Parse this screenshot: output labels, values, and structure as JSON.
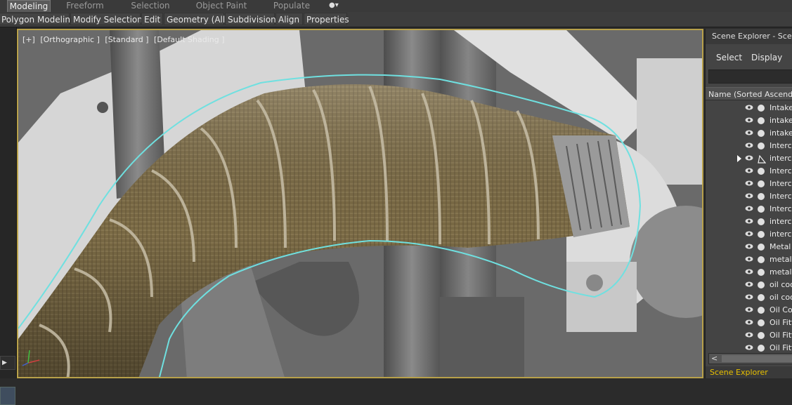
{
  "tabs": [
    {
      "label": "Modeling",
      "active": true
    },
    {
      "label": "Freeform",
      "active": false
    },
    {
      "label": "Selection",
      "active": false
    },
    {
      "label": "Object Paint",
      "active": false
    },
    {
      "label": "Populate",
      "active": false
    }
  ],
  "ribbon": {
    "buttons": [
      "Polygon Modeling",
      "Modify Selection",
      "Edit",
      "Geometry (All)",
      "Subdivision",
      "Align",
      "Properties"
    ]
  },
  "viewport": {
    "label_plus": "[+]",
    "label_view": "[Orthographic ]",
    "label_style": "[Standard ]",
    "label_shading": "[Default Shading ]"
  },
  "scene_explorer": {
    "title": "Scene Explorer - Scene",
    "menu": [
      "Select",
      "Display"
    ],
    "column_header": "Name (Sorted Ascending)",
    "rows": [
      {
        "label": "Intake",
        "selected": false
      },
      {
        "label": "intake",
        "selected": false
      },
      {
        "label": "intake",
        "selected": false
      },
      {
        "label": "Interco",
        "selected": false
      },
      {
        "label": "interco",
        "selected": true
      },
      {
        "label": "Interco",
        "selected": false
      },
      {
        "label": "Interco",
        "selected": false
      },
      {
        "label": "Interco",
        "selected": false
      },
      {
        "label": "Interco",
        "selected": false
      },
      {
        "label": "interco",
        "selected": false
      },
      {
        "label": "interco",
        "selected": false
      },
      {
        "label": "Metal C",
        "selected": false
      },
      {
        "label": "metal c",
        "selected": false
      },
      {
        "label": "metal c",
        "selected": false
      },
      {
        "label": "oil cool",
        "selected": false
      },
      {
        "label": "oil cool",
        "selected": false
      },
      {
        "label": "Oil Coo",
        "selected": false
      },
      {
        "label": "Oil Fitti",
        "selected": false
      },
      {
        "label": "Oil Fitti",
        "selected": false
      },
      {
        "label": "Oil Fitti",
        "selected": false
      }
    ],
    "footer": "Scene Explorer"
  },
  "colors": {
    "selection_outline": "#6fe0e0",
    "wrap_fabric": "#7a6a45",
    "footer_text": "#e8c000"
  }
}
